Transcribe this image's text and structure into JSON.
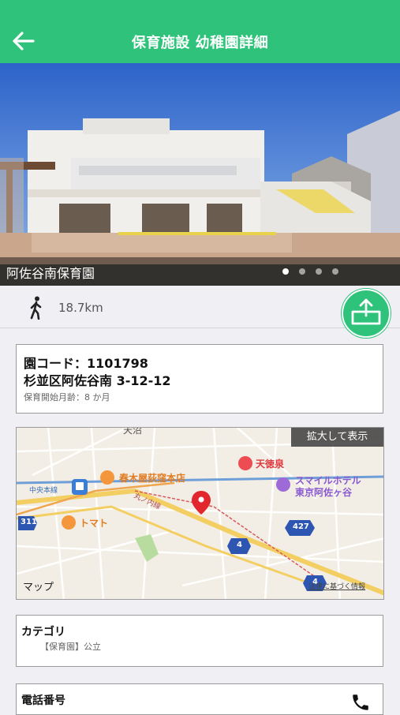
{
  "header": {
    "title": "保育施設 幼稚園詳細"
  },
  "photo": {
    "caption": "阿佐谷南保育園",
    "page_count": 4,
    "active_page": 1
  },
  "distance": {
    "text": "18.7km"
  },
  "info": {
    "code_line": "園コード：1101798",
    "address": "杉並区阿佐谷南 3-12-12",
    "age": "保育開始月齢：8 か月"
  },
  "map": {
    "enlarge_label": "拡大して表示",
    "apple_maps": "マップ",
    "legal": "法律に基づく情報",
    "place_harukiya": "春木屋荻窪本店",
    "place_tentokusen": "天徳泉",
    "place_hotel_1": "スマイルホテル",
    "place_hotel_2": "東京阿佐ヶ谷",
    "place_tomato": "トマト",
    "line_chuo": "中央本線",
    "line_marunouchi": "丸ノ内線",
    "road_311": "311",
    "road_427": "427",
    "road_4a": "4",
    "road_4b": "4",
    "area_top": "天沼"
  },
  "category": {
    "label": "カテゴリ",
    "value": "【保育園】公立"
  },
  "phone": {
    "label": "電話番号"
  }
}
